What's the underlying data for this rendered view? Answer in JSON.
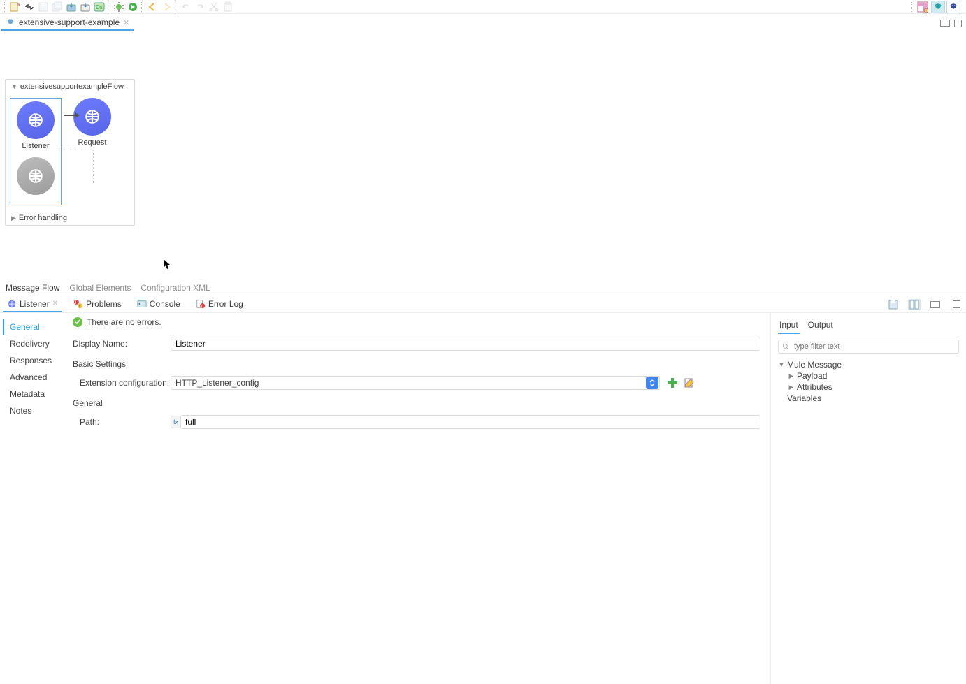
{
  "toolbar": {
    "perspectives": [
      "mule-design",
      "mule-debug"
    ]
  },
  "editor": {
    "tab_label": "extensive-support-example",
    "flow_name": "extensivesupportexampleFlow",
    "nodes": {
      "listener_label": "Listener",
      "request_label": "Request"
    },
    "error_section": "Error handling",
    "bottom_tabs": {
      "flow": "Message Flow",
      "globals": "Global Elements",
      "xml": "Configuration XML"
    }
  },
  "views": {
    "listener": "Listener",
    "problems": "Problems",
    "console": "Console",
    "errorlog": "Error Log"
  },
  "properties": {
    "status_text": "There are no errors.",
    "side": {
      "general": "General",
      "redelivery": "Redelivery",
      "responses": "Responses",
      "advanced": "Advanced",
      "metadata": "Metadata",
      "notes": "Notes"
    },
    "display_name_label": "Display Name:",
    "display_name_value": "Listener",
    "basic_settings_label": "Basic Settings",
    "ext_cfg_label": "Extension configuration:",
    "ext_cfg_value": "HTTP_Listener_config",
    "general_label": "General",
    "path_label": "Path:",
    "path_value": "full"
  },
  "io": {
    "tabs": {
      "input": "Input",
      "output": "Output"
    },
    "filter_placeholder": "type filter text",
    "tree": {
      "root": "Mule Message",
      "payload": "Payload",
      "attributes": "Attributes",
      "variables": "Variables"
    }
  }
}
